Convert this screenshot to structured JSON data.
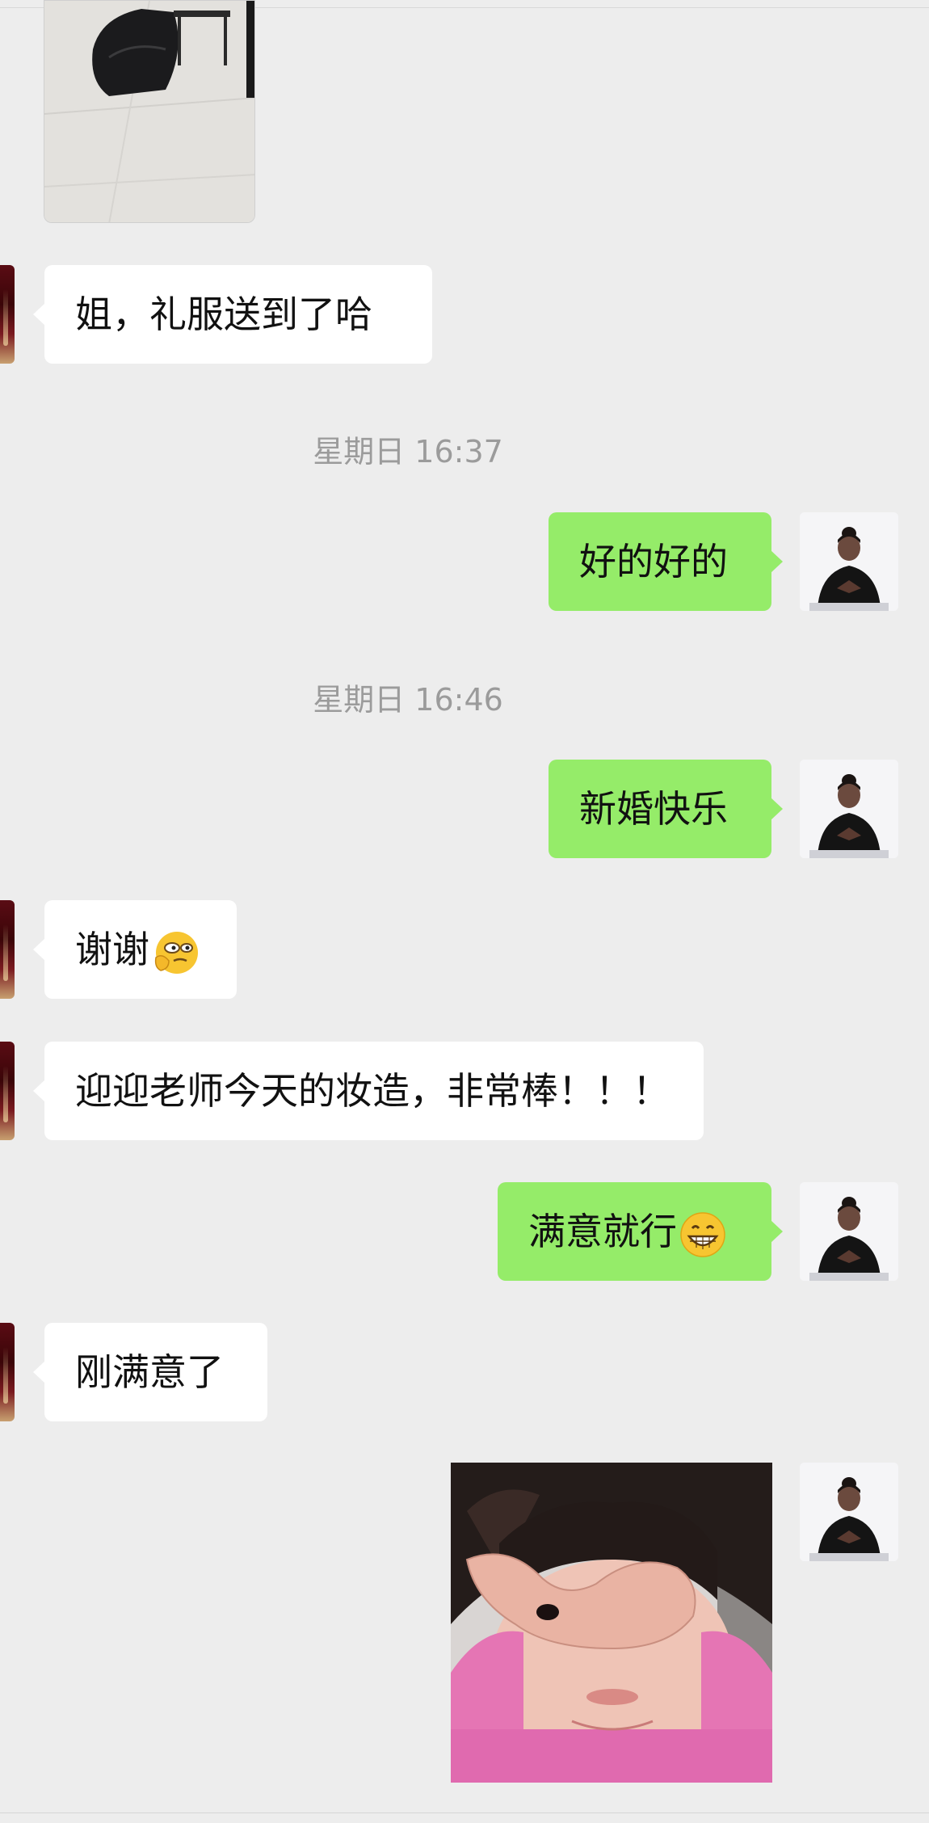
{
  "messages": [
    {
      "side": "left",
      "text": "姐，礼服送到了哈"
    },
    {
      "time": "星期日 16:37"
    },
    {
      "side": "right",
      "text": "好的好的"
    },
    {
      "time": "星期日 16:46"
    },
    {
      "side": "right",
      "text": "新婚快乐"
    },
    {
      "side": "left",
      "text": "谢谢",
      "emoji": "thinking-face-emoji"
    },
    {
      "side": "left",
      "text": "迎迎老师今天的妆造，非常棒！！！"
    },
    {
      "side": "right",
      "text": "满意就行",
      "emoji": "grinning-face-emoji"
    },
    {
      "side": "left",
      "text": "刚满意了"
    }
  ],
  "colors": {
    "background": "#ededed",
    "bubble_self": "#95ec69",
    "bubble_other": "#ffffff",
    "timestamp": "#9b9b9b"
  }
}
